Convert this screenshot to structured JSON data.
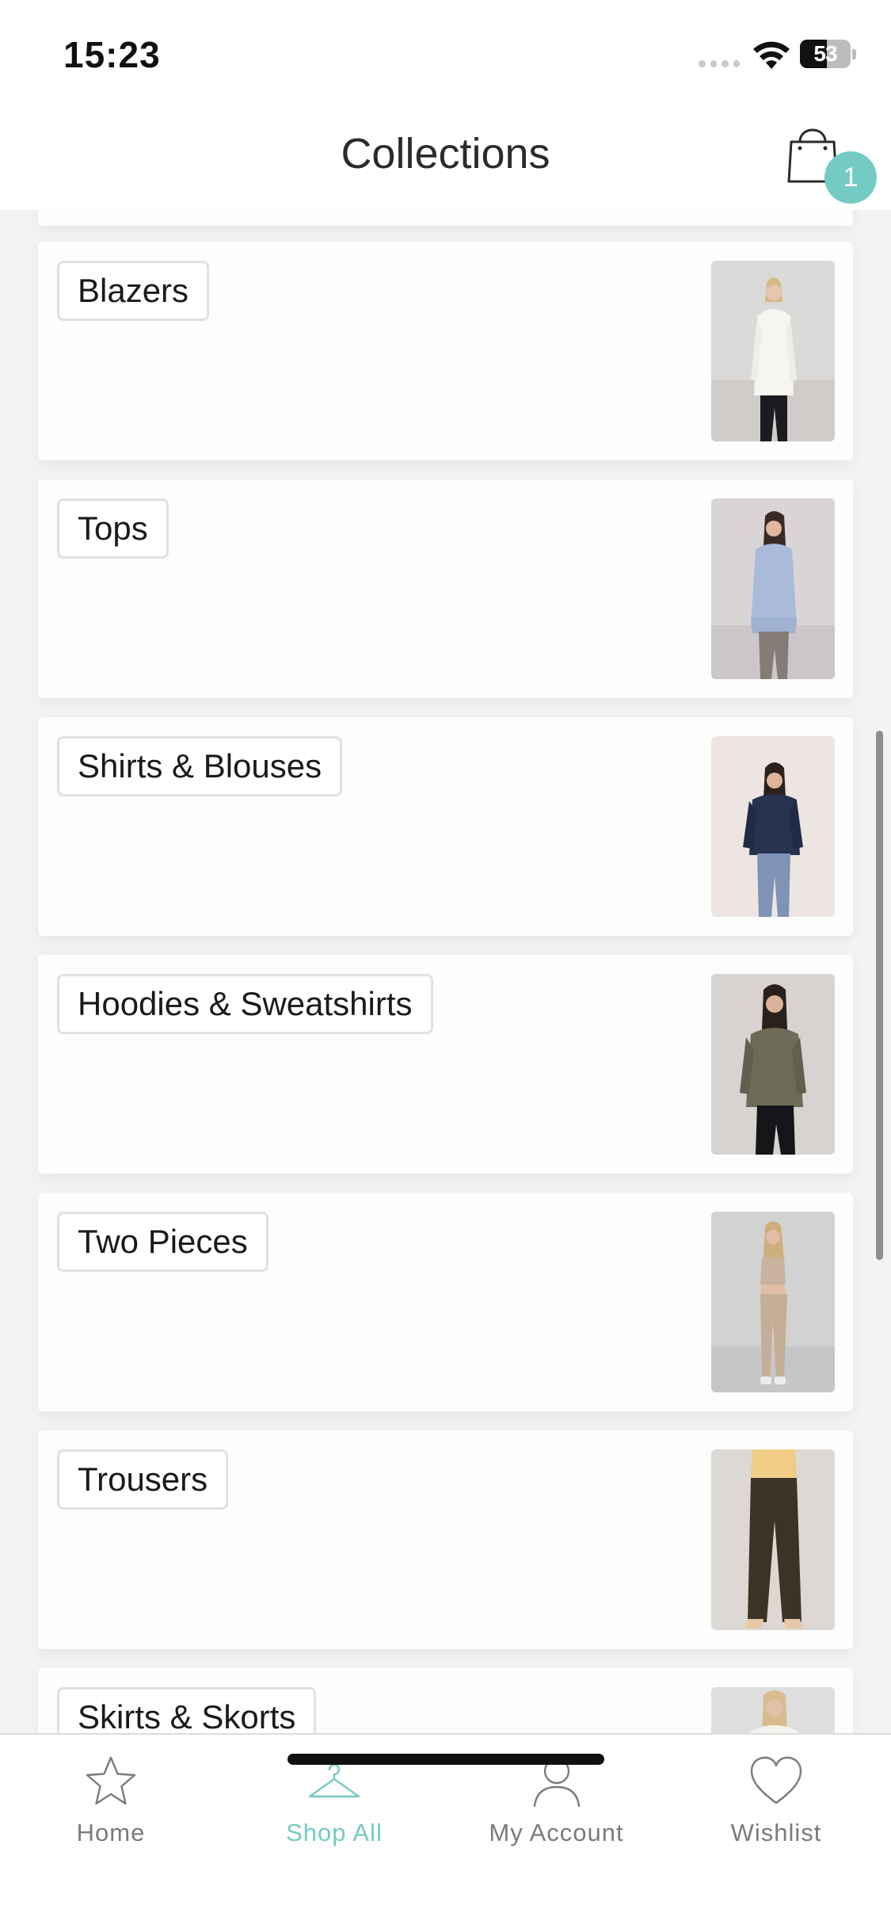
{
  "status_bar": {
    "time": "15:23",
    "battery_level": "53"
  },
  "header": {
    "title": "Collections",
    "cart_count": "1"
  },
  "collections": [
    {
      "label": "Blazers"
    },
    {
      "label": "Tops"
    },
    {
      "label": "Shirts & Blouses"
    },
    {
      "label": "Hoodies & Sweatshirts"
    },
    {
      "label": "Two Pieces"
    },
    {
      "label": "Trousers"
    },
    {
      "label": "Skirts & Skorts"
    }
  ],
  "tab_bar": {
    "tabs": [
      {
        "label": "Home",
        "icon": "star-icon",
        "active": false
      },
      {
        "label": "Shop All",
        "icon": "hanger-icon",
        "active": true
      },
      {
        "label": "My Account",
        "icon": "person-icon",
        "active": false
      },
      {
        "label": "Wishlist",
        "icon": "heart-icon",
        "active": false
      }
    ]
  },
  "colors": {
    "accent": "#73cbc4",
    "background": "#f3f3f3",
    "card": "#fdfdfd",
    "inactive_tab": "#7b7b7b"
  }
}
